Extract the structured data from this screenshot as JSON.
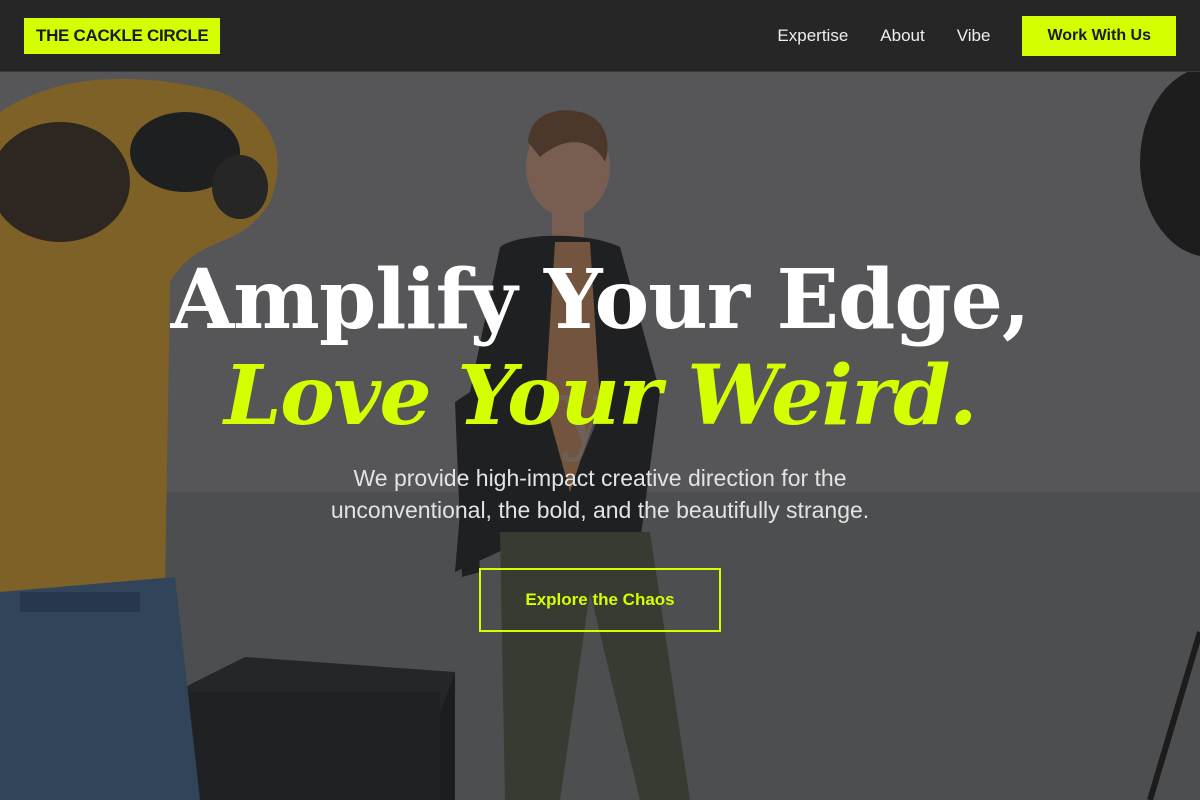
{
  "header": {
    "logo": "THE CACKLE CIRCLE",
    "nav": [
      {
        "label": "Expertise"
      },
      {
        "label": "About"
      },
      {
        "label": "Vibe"
      }
    ],
    "cta_label": "Work With Us"
  },
  "hero": {
    "headline": "Amplify Your Edge,",
    "headline_accent": "Love Your Weird.",
    "subtext_line1": "We provide high-impact creative direction for the",
    "subtext_line2": "unconventional, the bold, and the beautifully strange.",
    "button_label": "Explore the Chaos"
  },
  "colors": {
    "accent": "#d4ff00",
    "header_bg": "#262626",
    "text_light": "#ffffff"
  }
}
